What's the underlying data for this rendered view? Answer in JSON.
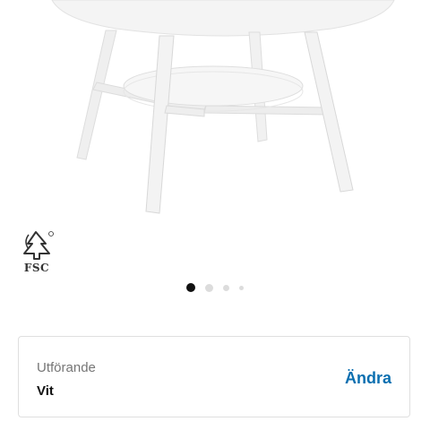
{
  "product": {
    "image_description_icon": "white-round-coffee-table-icon"
  },
  "certification": {
    "logo_icon": "fsc-tree-logo-icon",
    "logo_text": "FSC"
  },
  "carousel": {
    "total_dots": 4,
    "active_index": 0
  },
  "variant": {
    "label": "Utförande",
    "value": "Vit",
    "change_label": "Ändra",
    "accent_color": "#0a6fb0"
  }
}
